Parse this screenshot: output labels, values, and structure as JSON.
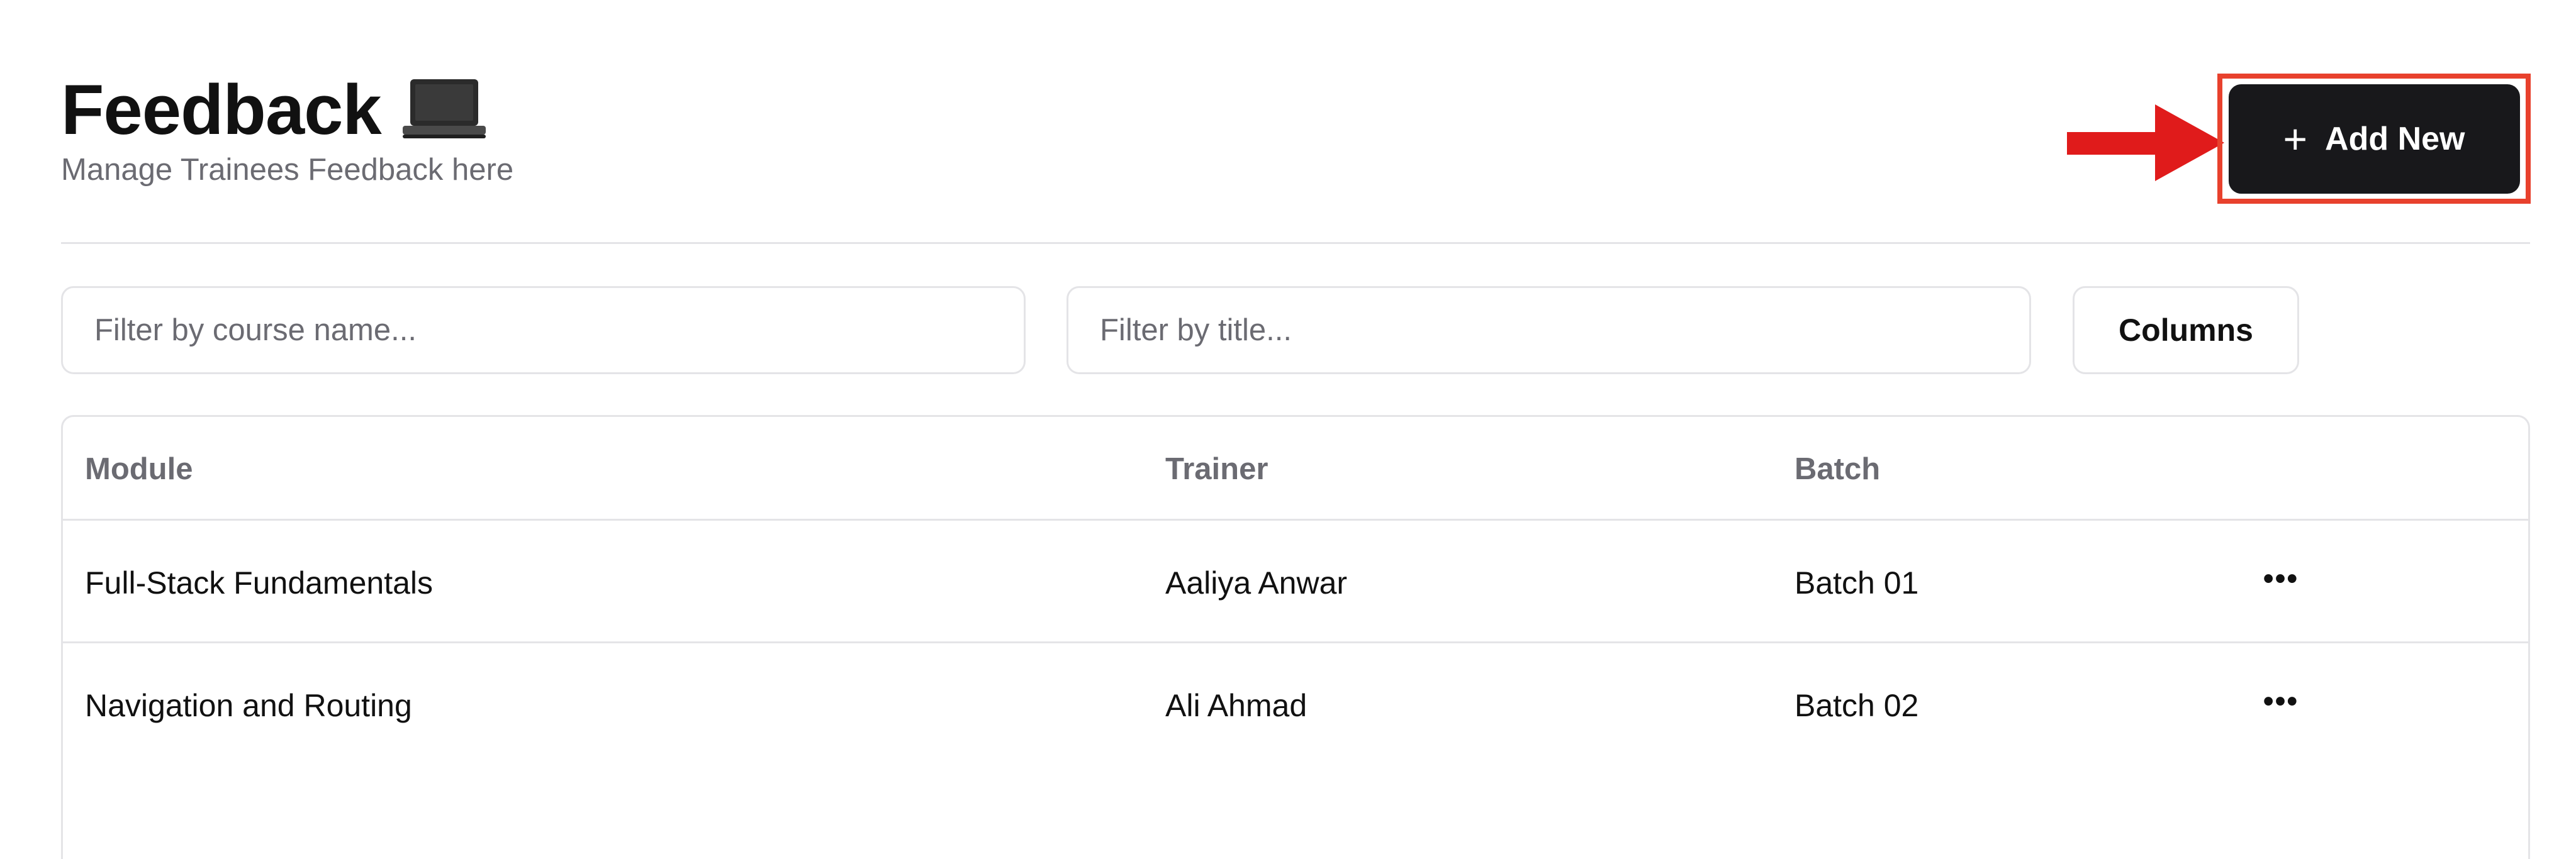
{
  "header": {
    "title": "Feedback",
    "title_icon": "laptop-icon",
    "subtitle": "Manage Trainees Feedback here"
  },
  "toolbar": {
    "add_label": "Add New",
    "add_icon": "plus-icon",
    "highlight_color": "#e8412d",
    "arrow_color": "#e01b1b"
  },
  "filters": {
    "course_placeholder": "Filter by course name...",
    "title_placeholder": "Filter by title...",
    "columns_label": "Columns"
  },
  "table": {
    "headers": [
      "Module",
      "Trainer",
      "Batch"
    ],
    "rows": [
      {
        "module": "Full-Stack Fundamentals",
        "trainer": "Aaliya Anwar",
        "batch": "Batch 01",
        "menu": "•••"
      },
      {
        "module": "Navigation and Routing",
        "trainer": "Ali Ahmad",
        "batch": "Batch 02",
        "menu": "•••"
      }
    ]
  },
  "colors": {
    "primary_button": "#18181b",
    "border": "#e4e4e7",
    "muted_text": "#6b6b72"
  }
}
